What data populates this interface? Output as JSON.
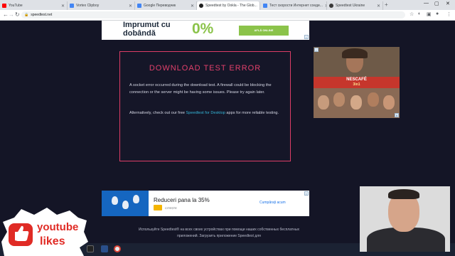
{
  "browser": {
    "tabs": [
      {
        "label": "YouTube",
        "favicon_color": "#ff0000"
      },
      {
        "label": "Vortex Clipboy",
        "favicon_color": "#4285f4"
      },
      {
        "label": "Google Переводчик",
        "favicon_color": "#4285f4"
      },
      {
        "label": "Speedtest by Ookla - The Glob...",
        "favicon_color": "#1f1f1f"
      },
      {
        "label": "Тест скорости Интернет соеди...",
        "favicon_color": "#4285f4"
      },
      {
        "label": "Speedtest Ukraine",
        "favicon_color": "#3a3a3a"
      }
    ],
    "new_tab": "+",
    "window_controls": {
      "minimize": "—",
      "maximize": "▢",
      "close": "✕"
    },
    "url": "speedtest.net"
  },
  "ads": {
    "top": {
      "headline": "Imprumut cu dobândă",
      "value": "0%",
      "cta": "AFLĂ ONLINE"
    },
    "right": {
      "brand": "NESCAFÉ",
      "product": "3in1"
    },
    "bottom": {
      "headline": "Reduceri pana la 35%",
      "sub": "CITEȘTE",
      "cta": "Cumpărați acum"
    }
  },
  "error": {
    "title": "DOWNLOAD TEST ERROR",
    "paragraph1": "A socket error occurred during the download test. A firewall could be blocking the connection or the server might be having some issues. Please try again later.",
    "paragraph2_prefix": "Alternatively, check out our free ",
    "paragraph2_link": "Speedtest for Desktop",
    "paragraph2_suffix": " apps for more reliable testing."
  },
  "footer": {
    "text": "Используйте Speedtest® на всех своих устройствах при помощи наших собственных бесплатных приложений. Загрузить приложение Speedtest для"
  },
  "sticker": {
    "line1": "youtube",
    "line2": "likes"
  },
  "colors": {
    "page_bg": "#141526",
    "error_accent": "#e1406b",
    "link": "#35b6d8"
  }
}
